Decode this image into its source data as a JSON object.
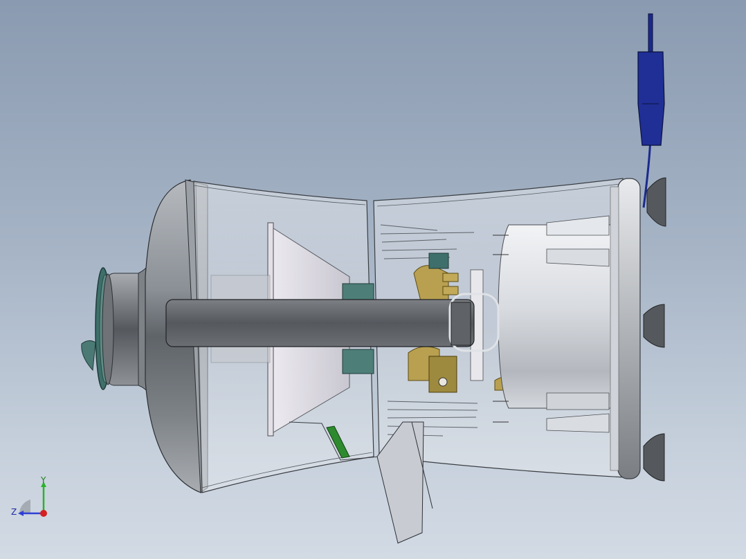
{
  "viewport": {
    "background_top": "#8a9ab0",
    "background_bottom": "#d2dae4"
  },
  "triad": {
    "x_label": "",
    "y_label": "Y",
    "z_label": "Z",
    "y_color": "#2bb32b",
    "z_color": "#2f3fd6",
    "x_color": "#d42020"
  },
  "model": {
    "housing_color": "#d9dde3",
    "handle_color": "#5a5d61",
    "bell_color": "#6f7378",
    "cable_color": "#1a2a8c",
    "brass_color": "#b8a050",
    "teal_color": "#3e6f6a"
  }
}
